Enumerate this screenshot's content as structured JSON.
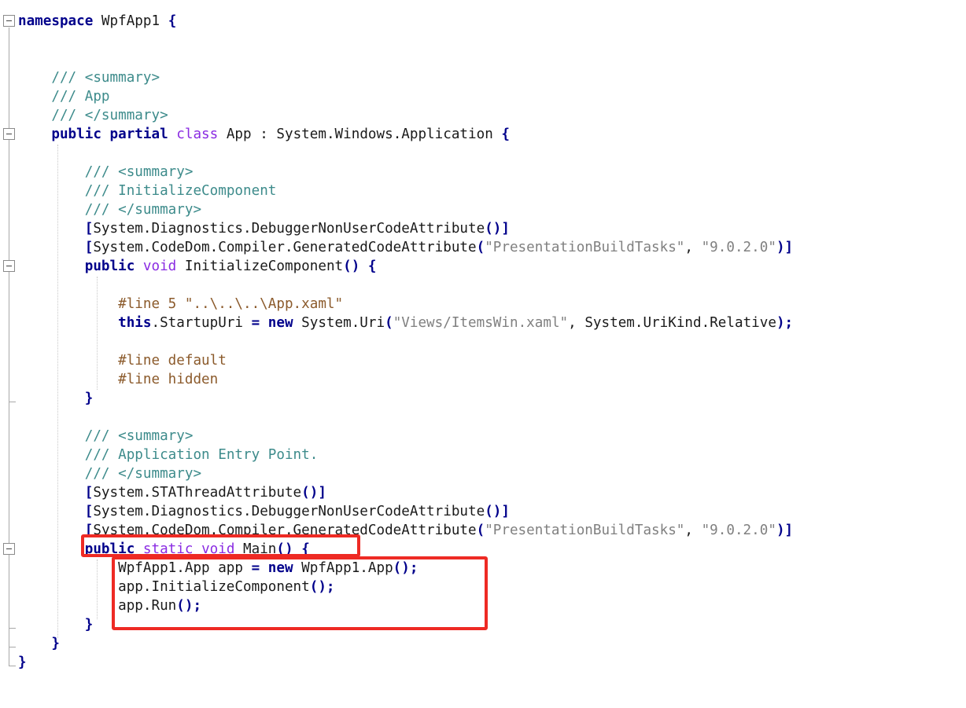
{
  "editor": {
    "lines": [
      [
        {
          "t": "namespace",
          "c": "kw"
        },
        {
          "t": " WpfApp1 "
        },
        {
          "t": "{",
          "c": "pun"
        }
      ],
      [],
      [],
      [
        {
          "t": "    "
        },
        {
          "t": "/// <summary>",
          "c": "cm"
        }
      ],
      [
        {
          "t": "    "
        },
        {
          "t": "/// App",
          "c": "cm"
        }
      ],
      [
        {
          "t": "    "
        },
        {
          "t": "/// </summary>",
          "c": "cm"
        }
      ],
      [
        {
          "t": "    "
        },
        {
          "t": "public",
          "c": "kw"
        },
        {
          "t": " "
        },
        {
          "t": "partial",
          "c": "kw"
        },
        {
          "t": " "
        },
        {
          "t": "class",
          "c": "kw2"
        },
        {
          "t": " App : System.Windows.Application "
        },
        {
          "t": "{",
          "c": "pun"
        }
      ],
      [],
      [
        {
          "t": "        "
        },
        {
          "t": "/// <summary>",
          "c": "cm"
        }
      ],
      [
        {
          "t": "        "
        },
        {
          "t": "/// InitializeComponent",
          "c": "cm"
        }
      ],
      [
        {
          "t": "        "
        },
        {
          "t": "/// </summary>",
          "c": "cm"
        }
      ],
      [
        {
          "t": "        "
        },
        {
          "t": "[",
          "c": "pun"
        },
        {
          "t": "System.Diagnostics.DebuggerNonUserCodeAttribute"
        },
        {
          "t": "()]",
          "c": "pun"
        }
      ],
      [
        {
          "t": "        "
        },
        {
          "t": "[",
          "c": "pun"
        },
        {
          "t": "System.CodeDom.Compiler.GeneratedCodeAttribute"
        },
        {
          "t": "(",
          "c": "pun"
        },
        {
          "t": "\"PresentationBuildTasks\"",
          "c": "str"
        },
        {
          "t": ", "
        },
        {
          "t": "\"9.0.2.0\"",
          "c": "str"
        },
        {
          "t": ")]",
          "c": "pun"
        }
      ],
      [
        {
          "t": "        "
        },
        {
          "t": "public",
          "c": "kw"
        },
        {
          "t": " "
        },
        {
          "t": "void",
          "c": "kw2"
        },
        {
          "t": " InitializeComponent"
        },
        {
          "t": "()",
          "c": "pun"
        },
        {
          "t": " "
        },
        {
          "t": "{",
          "c": "pun"
        }
      ],
      [],
      [
        {
          "t": "            "
        },
        {
          "t": "#line 5 \"..\\..\\..\\App.xaml\"",
          "c": "pp"
        }
      ],
      [
        {
          "t": "            "
        },
        {
          "t": "this",
          "c": "kw"
        },
        {
          "t": ".StartupUri "
        },
        {
          "t": "=",
          "c": "pun"
        },
        {
          "t": " "
        },
        {
          "t": "new",
          "c": "kw"
        },
        {
          "t": " System.Uri"
        },
        {
          "t": "(",
          "c": "pun"
        },
        {
          "t": "\"Views/ItemsWin.xaml\"",
          "c": "str"
        },
        {
          "t": ", System.UriKind.Relative"
        },
        {
          "t": ");",
          "c": "pun"
        }
      ],
      [],
      [
        {
          "t": "            "
        },
        {
          "t": "#line default",
          "c": "pp"
        }
      ],
      [
        {
          "t": "            "
        },
        {
          "t": "#line hidden",
          "c": "pp"
        }
      ],
      [
        {
          "t": "        "
        },
        {
          "t": "}",
          "c": "pun"
        }
      ],
      [],
      [
        {
          "t": "        "
        },
        {
          "t": "/// <summary>",
          "c": "cm"
        }
      ],
      [
        {
          "t": "        "
        },
        {
          "t": "/// Application Entry Point.",
          "c": "cm"
        }
      ],
      [
        {
          "t": "        "
        },
        {
          "t": "/// </summary>",
          "c": "cm"
        }
      ],
      [
        {
          "t": "        "
        },
        {
          "t": "[",
          "c": "pun"
        },
        {
          "t": "System.STAThreadAttribute"
        },
        {
          "t": "()]",
          "c": "pun"
        }
      ],
      [
        {
          "t": "        "
        },
        {
          "t": "[",
          "c": "pun"
        },
        {
          "t": "System.Diagnostics.DebuggerNonUserCodeAttribute"
        },
        {
          "t": "()]",
          "c": "pun"
        }
      ],
      [
        {
          "t": "        "
        },
        {
          "t": "[",
          "c": "pun"
        },
        {
          "t": "System.CodeDom.Compiler.GeneratedCodeAttribute"
        },
        {
          "t": "(",
          "c": "pun"
        },
        {
          "t": "\"PresentationBuildTasks\"",
          "c": "str"
        },
        {
          "t": ", "
        },
        {
          "t": "\"9.0.2.0\"",
          "c": "str"
        },
        {
          "t": ")]",
          "c": "pun"
        }
      ],
      [
        {
          "t": "        "
        },
        {
          "t": "public",
          "c": "kw"
        },
        {
          "t": " "
        },
        {
          "t": "static",
          "c": "kw2"
        },
        {
          "t": " "
        },
        {
          "t": "void",
          "c": "kw2"
        },
        {
          "t": " Main"
        },
        {
          "t": "()",
          "c": "pun"
        },
        {
          "t": " "
        },
        {
          "t": "{",
          "c": "pun"
        }
      ],
      [
        {
          "t": "            WpfApp1.App app "
        },
        {
          "t": "=",
          "c": "pun"
        },
        {
          "t": " "
        },
        {
          "t": "new",
          "c": "kw"
        },
        {
          "t": " WpfApp1.App"
        },
        {
          "t": "();",
          "c": "pun"
        }
      ],
      [
        {
          "t": "            app.InitializeComponent"
        },
        {
          "t": "();",
          "c": "pun"
        }
      ],
      [
        {
          "t": "            app.Run"
        },
        {
          "t": "();",
          "c": "pun"
        }
      ],
      [
        {
          "t": "        "
        },
        {
          "t": "}",
          "c": "pun"
        }
      ],
      [
        {
          "t": "    "
        },
        {
          "t": "}",
          "c": "pun"
        }
      ],
      [
        {
          "t": "}",
          "c": "pun"
        }
      ]
    ]
  },
  "colors": {
    "keyword": "#00008b",
    "keyword_secondary": "#8a2be2",
    "comment": "#3d8b8b",
    "string": "#808080",
    "preprocessor": "#8b5a2b",
    "highlight_box": "#ee2a24"
  }
}
